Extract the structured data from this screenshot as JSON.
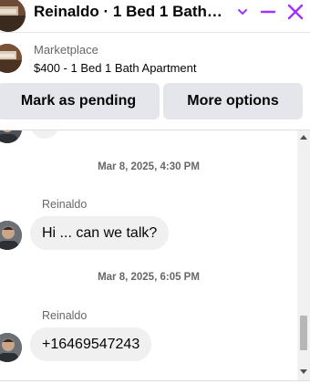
{
  "header": {
    "title": "Reinaldo · 1 Bed 1 Bath Apartment",
    "avatar_icon": "listing-photo-icon",
    "chevron_icon": "chevron-down-icon",
    "minimize_icon": "minimize-icon",
    "close_icon": "close-icon",
    "accent_color": "#a033ff"
  },
  "listing": {
    "label": "Marketplace",
    "price_title": "$400 - 1 Bed 1 Bath Apartment"
  },
  "actions": {
    "mark_pending": "Mark as pending",
    "more_options": "More options"
  },
  "thread": {
    "messages": [
      {
        "timestamp": "Mar 8, 2025, 4:30 PM",
        "sender": "Reinaldo",
        "text": "Hi ... can we talk?"
      },
      {
        "timestamp": "Mar 8, 2025, 6:05 PM",
        "sender": "Reinaldo",
        "text": "+16469547243"
      }
    ]
  },
  "colors": {
    "bubble_bg": "#f0f0f0",
    "button_bg": "#e4e6eb",
    "muted_text": "#65676b"
  }
}
